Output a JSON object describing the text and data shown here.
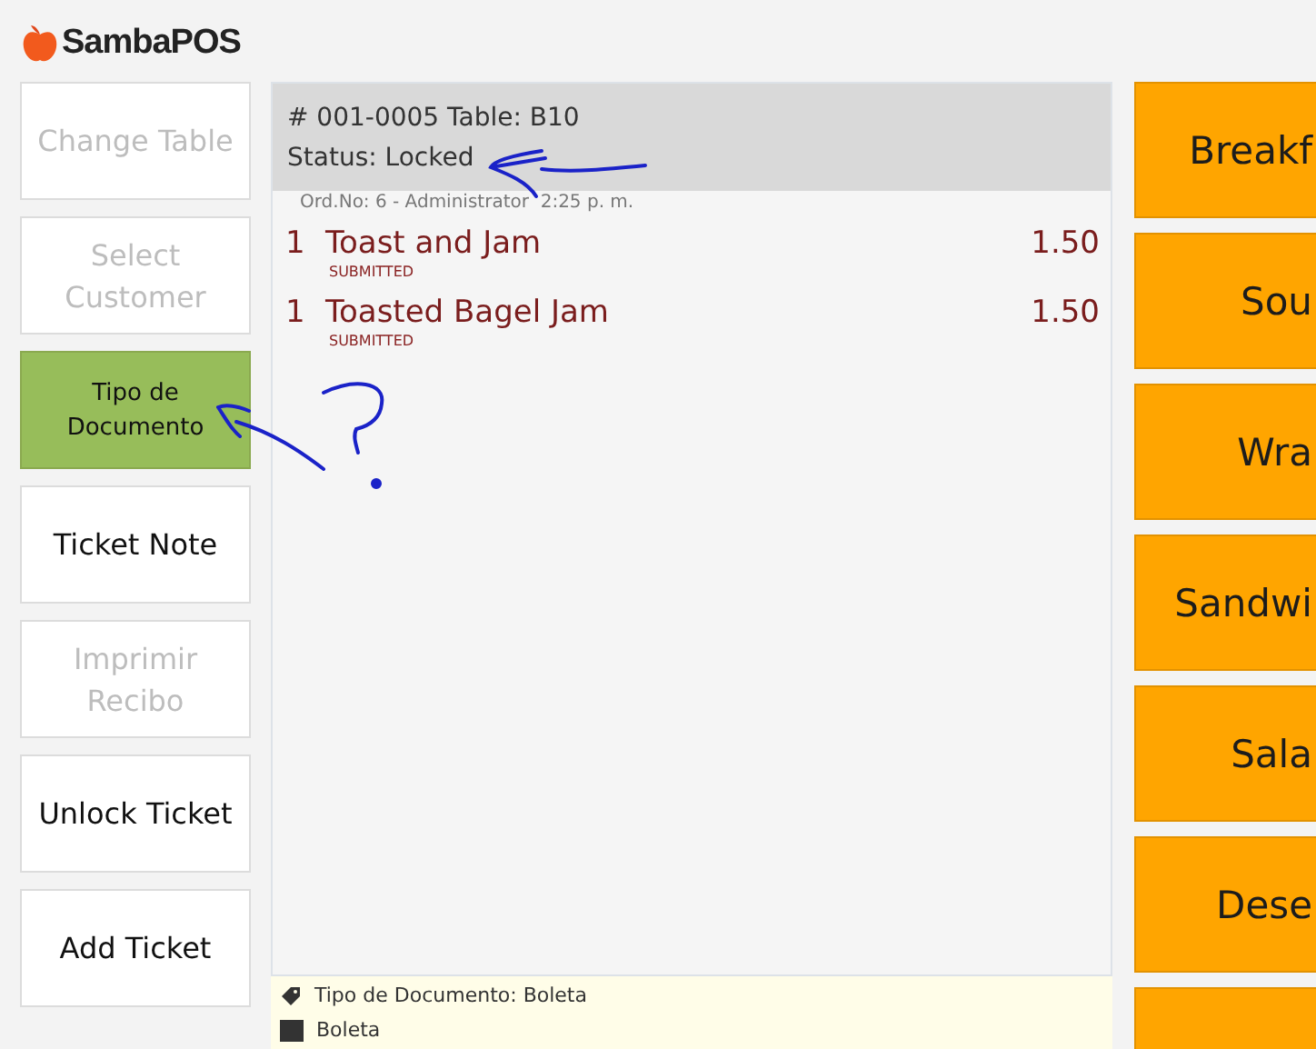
{
  "logo": {
    "text": "SambaPOS"
  },
  "actions": [
    {
      "label": "Change Table",
      "disabled": true,
      "highlighted": false
    },
    {
      "label": "Select Customer",
      "disabled": true,
      "highlighted": false
    },
    {
      "label": "Tipo de Documento",
      "disabled": false,
      "highlighted": true
    },
    {
      "label": "Ticket Note",
      "disabled": false,
      "highlighted": false
    },
    {
      "label": "Imprimir Recibo",
      "disabled": true,
      "highlighted": false
    },
    {
      "label": "Unlock Ticket",
      "disabled": false,
      "highlighted": false
    },
    {
      "label": "Add Ticket",
      "disabled": false,
      "highlighted": false
    }
  ],
  "ticket": {
    "header": "# 001-0005 Table: B10",
    "status": "Status: Locked",
    "order_info": "Ord.No: 6 - Administrator  2:25 p. m.",
    "orders": [
      {
        "quantity": "1",
        "name": "Toast and Jam",
        "price": "1.50",
        "state": "SUBMITTED"
      },
      {
        "quantity": "1",
        "name": "Toasted Bagel Jam",
        "price": "1.50",
        "state": "SUBMITTED"
      }
    ],
    "tags": [
      {
        "kind": "tag",
        "text": "Tipo de Documento: Boleta"
      },
      {
        "kind": "square",
        "text": "Boleta"
      }
    ]
  },
  "categories": [
    {
      "label": "Breakf"
    },
    {
      "label": "Sou"
    },
    {
      "label": "Wra"
    },
    {
      "label": "Sandwi"
    },
    {
      "label": "Sala"
    },
    {
      "label": "Dese"
    }
  ]
}
